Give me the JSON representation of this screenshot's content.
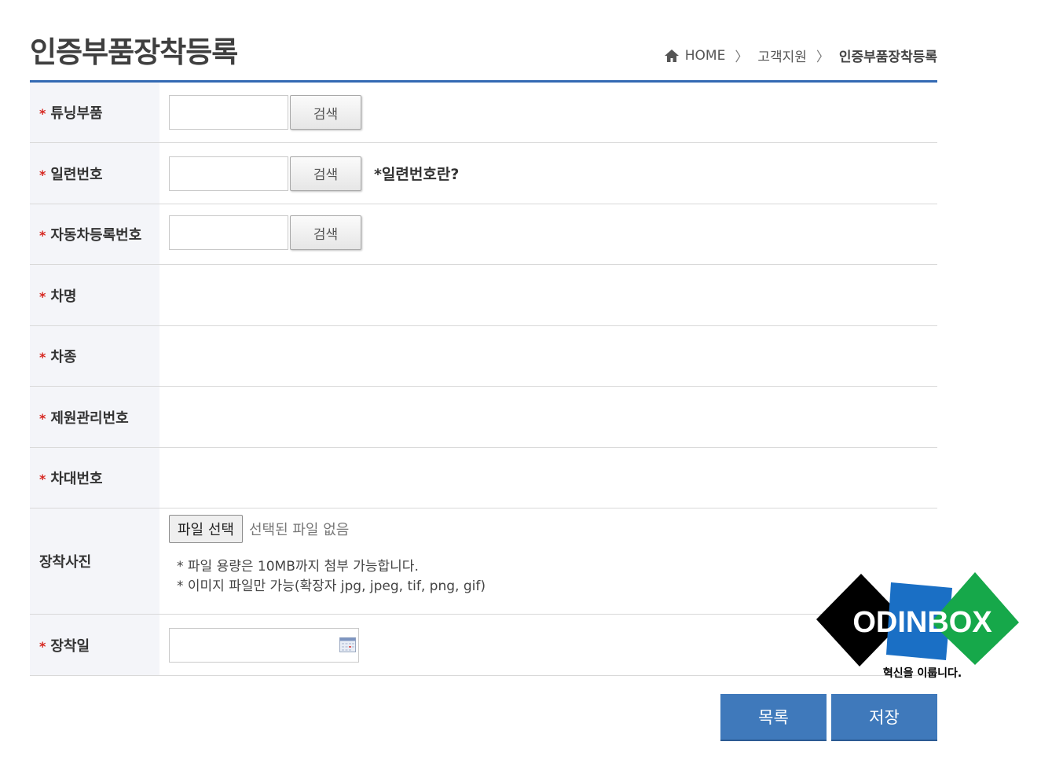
{
  "page": {
    "title": "인증부품장착등록"
  },
  "breadcrumb": {
    "home": "HOME",
    "level1": "고객지원",
    "current": "인증부품장착등록"
  },
  "form": {
    "req_mark": "*",
    "rows": [
      {
        "label": "튜닝부품",
        "button": "검색"
      },
      {
        "label": "일련번호",
        "button": "검색",
        "help": "*일련번호란?"
      },
      {
        "label": "자동차등록번호",
        "button": "검색"
      },
      {
        "label": "차명"
      },
      {
        "label": "차종"
      },
      {
        "label": "제원관리번호"
      },
      {
        "label": "차대번호"
      },
      {
        "label": "장착사진"
      },
      {
        "label": "장착일"
      }
    ],
    "file": {
      "button": "파일 선택",
      "status": "선택된 파일 없음",
      "note1": "* 파일 용량은 10MB까지 첨부 가능합니다.",
      "note2": "* 이미지 파일만 가능(확장자 jpg, jpeg, tif, png, gif)"
    }
  },
  "actions": {
    "list": "목록",
    "save": "저장"
  },
  "watermark": {
    "brand": "ODINBOX",
    "slogan": "혁신을 이룹니다."
  },
  "colors": {
    "accent": "#3369b3",
    "button": "#3f79bb",
    "required": "#d6261f"
  }
}
